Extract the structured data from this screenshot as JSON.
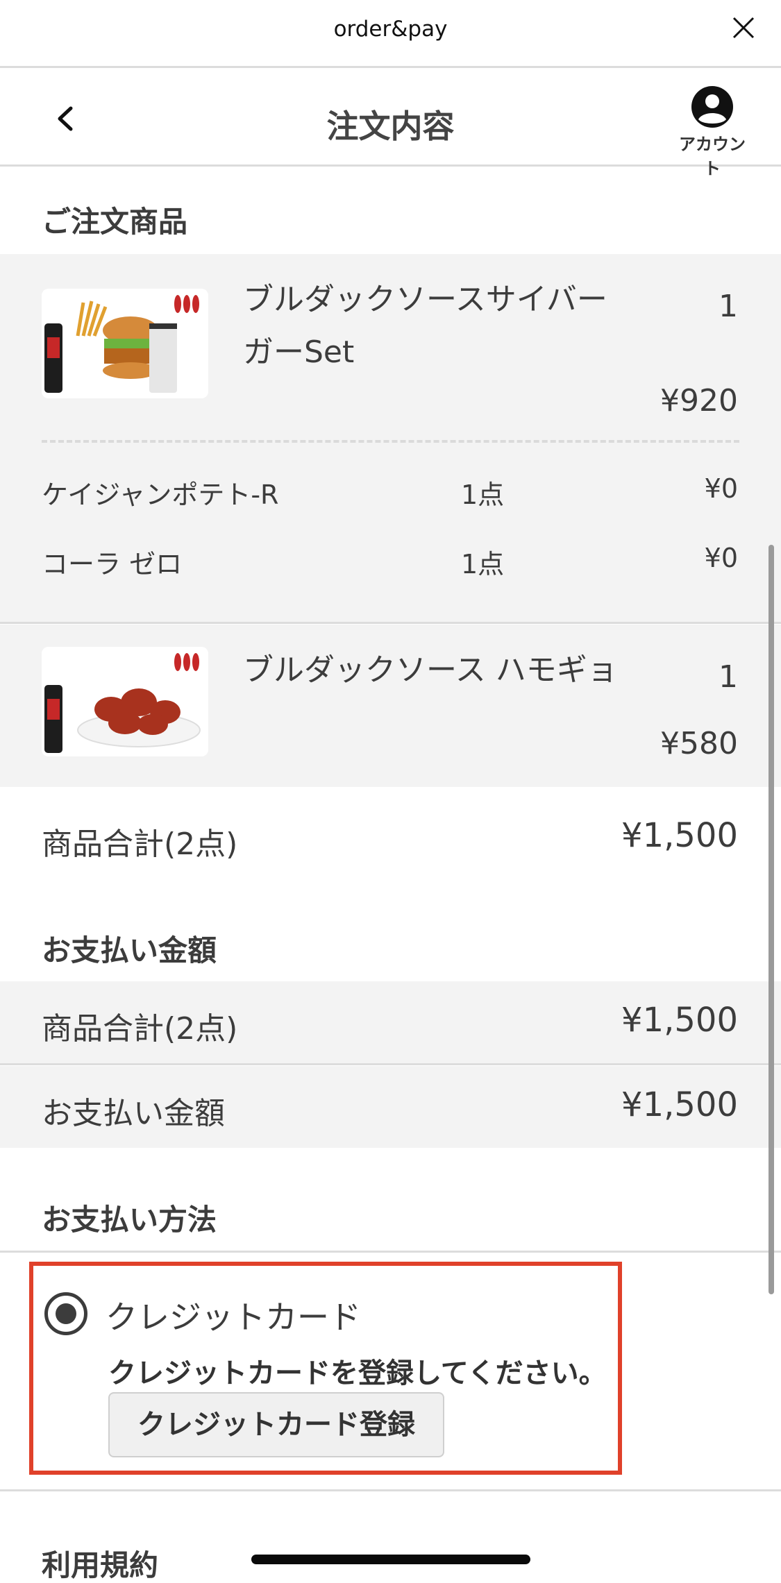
{
  "top_bar": {
    "title": "order&pay",
    "close_icon": "close-icon"
  },
  "nav": {
    "title": "注文内容",
    "back_icon": "chevron-left-icon",
    "account_label": "アカウント",
    "account_icon": "account-circle-icon"
  },
  "order_section": {
    "heading": "ご注文商品",
    "items": [
      {
        "name": "ブルダックソースサイバーガーSet",
        "name_line1": "ブルダックソースサイバー",
        "name_line2": "ガーSet",
        "quantity": "1",
        "price": "¥920",
        "options": [
          {
            "name": "ケイジャンポテト-R",
            "quantity": "1点",
            "price": "¥0"
          },
          {
            "name": "コーラ ゼロ",
            "quantity": "1点",
            "price": "¥0"
          }
        ]
      },
      {
        "name": "ブルダックソース ハモギョ",
        "quantity": "1",
        "price": "¥580"
      }
    ],
    "subtotal_label": "商品合計(2点)",
    "subtotal_value": "¥1,500"
  },
  "payment_amount": {
    "heading": "お支払い金額",
    "rows": [
      {
        "label": "商品合計(2点)",
        "value": "¥1,500"
      },
      {
        "label": "お支払い金額",
        "value": "¥1,500"
      }
    ]
  },
  "payment_method": {
    "heading": "お支払い方法",
    "option_label": "クレジットカード",
    "selected": true,
    "note": "クレジットカードを登録してください。",
    "register_button": "クレジットカード登録",
    "highlight_color": "#e0412a"
  },
  "terms": {
    "heading": "利用規約"
  }
}
